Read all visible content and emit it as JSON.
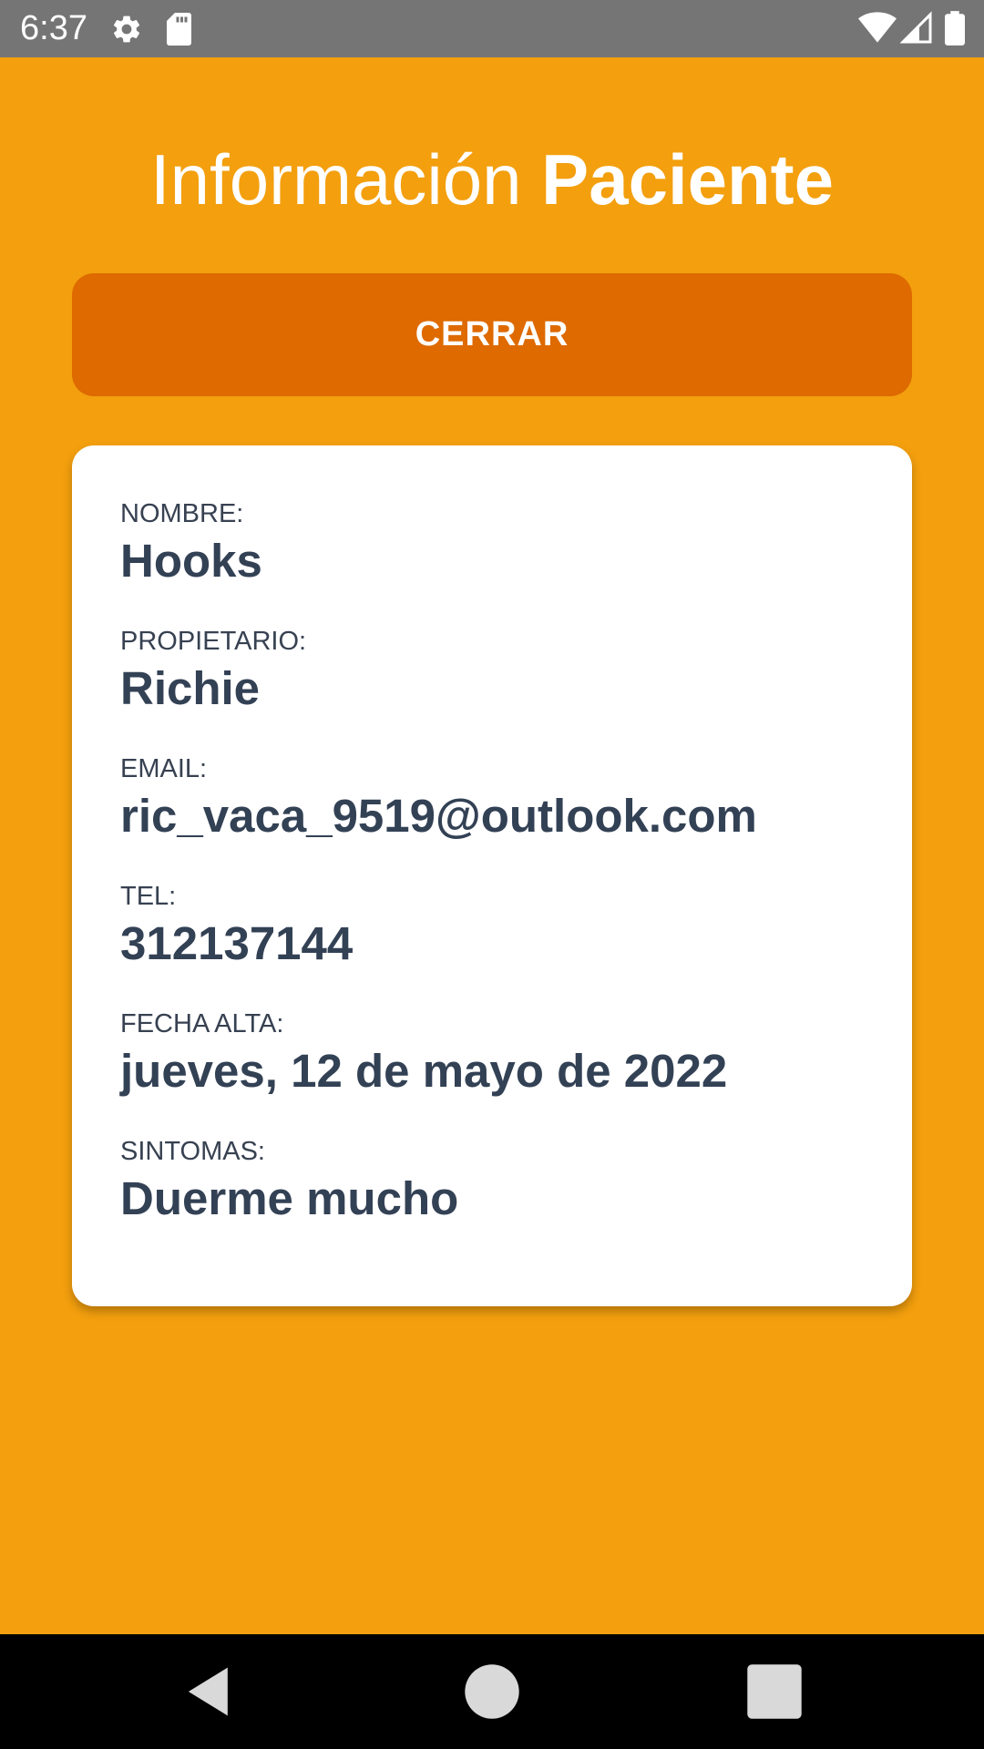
{
  "status_bar": {
    "time": "6:37",
    "icons": [
      "gear-icon",
      "sd-card-icon",
      "wifi-icon",
      "signal-icon",
      "battery-icon"
    ]
  },
  "header": {
    "title_part1": "Información",
    "title_part2": "Paciente"
  },
  "close_button": {
    "label": "CERRAR"
  },
  "patient": {
    "fields": [
      {
        "label": "NOMBRE:",
        "value": "Hooks"
      },
      {
        "label": "PROPIETARIO:",
        "value": "Richie"
      },
      {
        "label": "EMAIL:",
        "value": "ric_vaca_9519@outlook.com"
      },
      {
        "label": "TEL:",
        "value": "312137144"
      },
      {
        "label": "FECHA ALTA:",
        "value": "jueves, 12 de mayo de 2022"
      },
      {
        "label": "SINTOMAS:",
        "value": "Duerme mucho"
      }
    ]
  },
  "nav_bar": {
    "buttons": [
      "back-icon",
      "home-icon",
      "recents-icon"
    ]
  },
  "colors": {
    "background": "#f39f0e",
    "button": "#de6a00",
    "card": "#ffffff",
    "text_dark": "#334155",
    "status_bar": "#757575",
    "nav_bar": "#000000"
  }
}
